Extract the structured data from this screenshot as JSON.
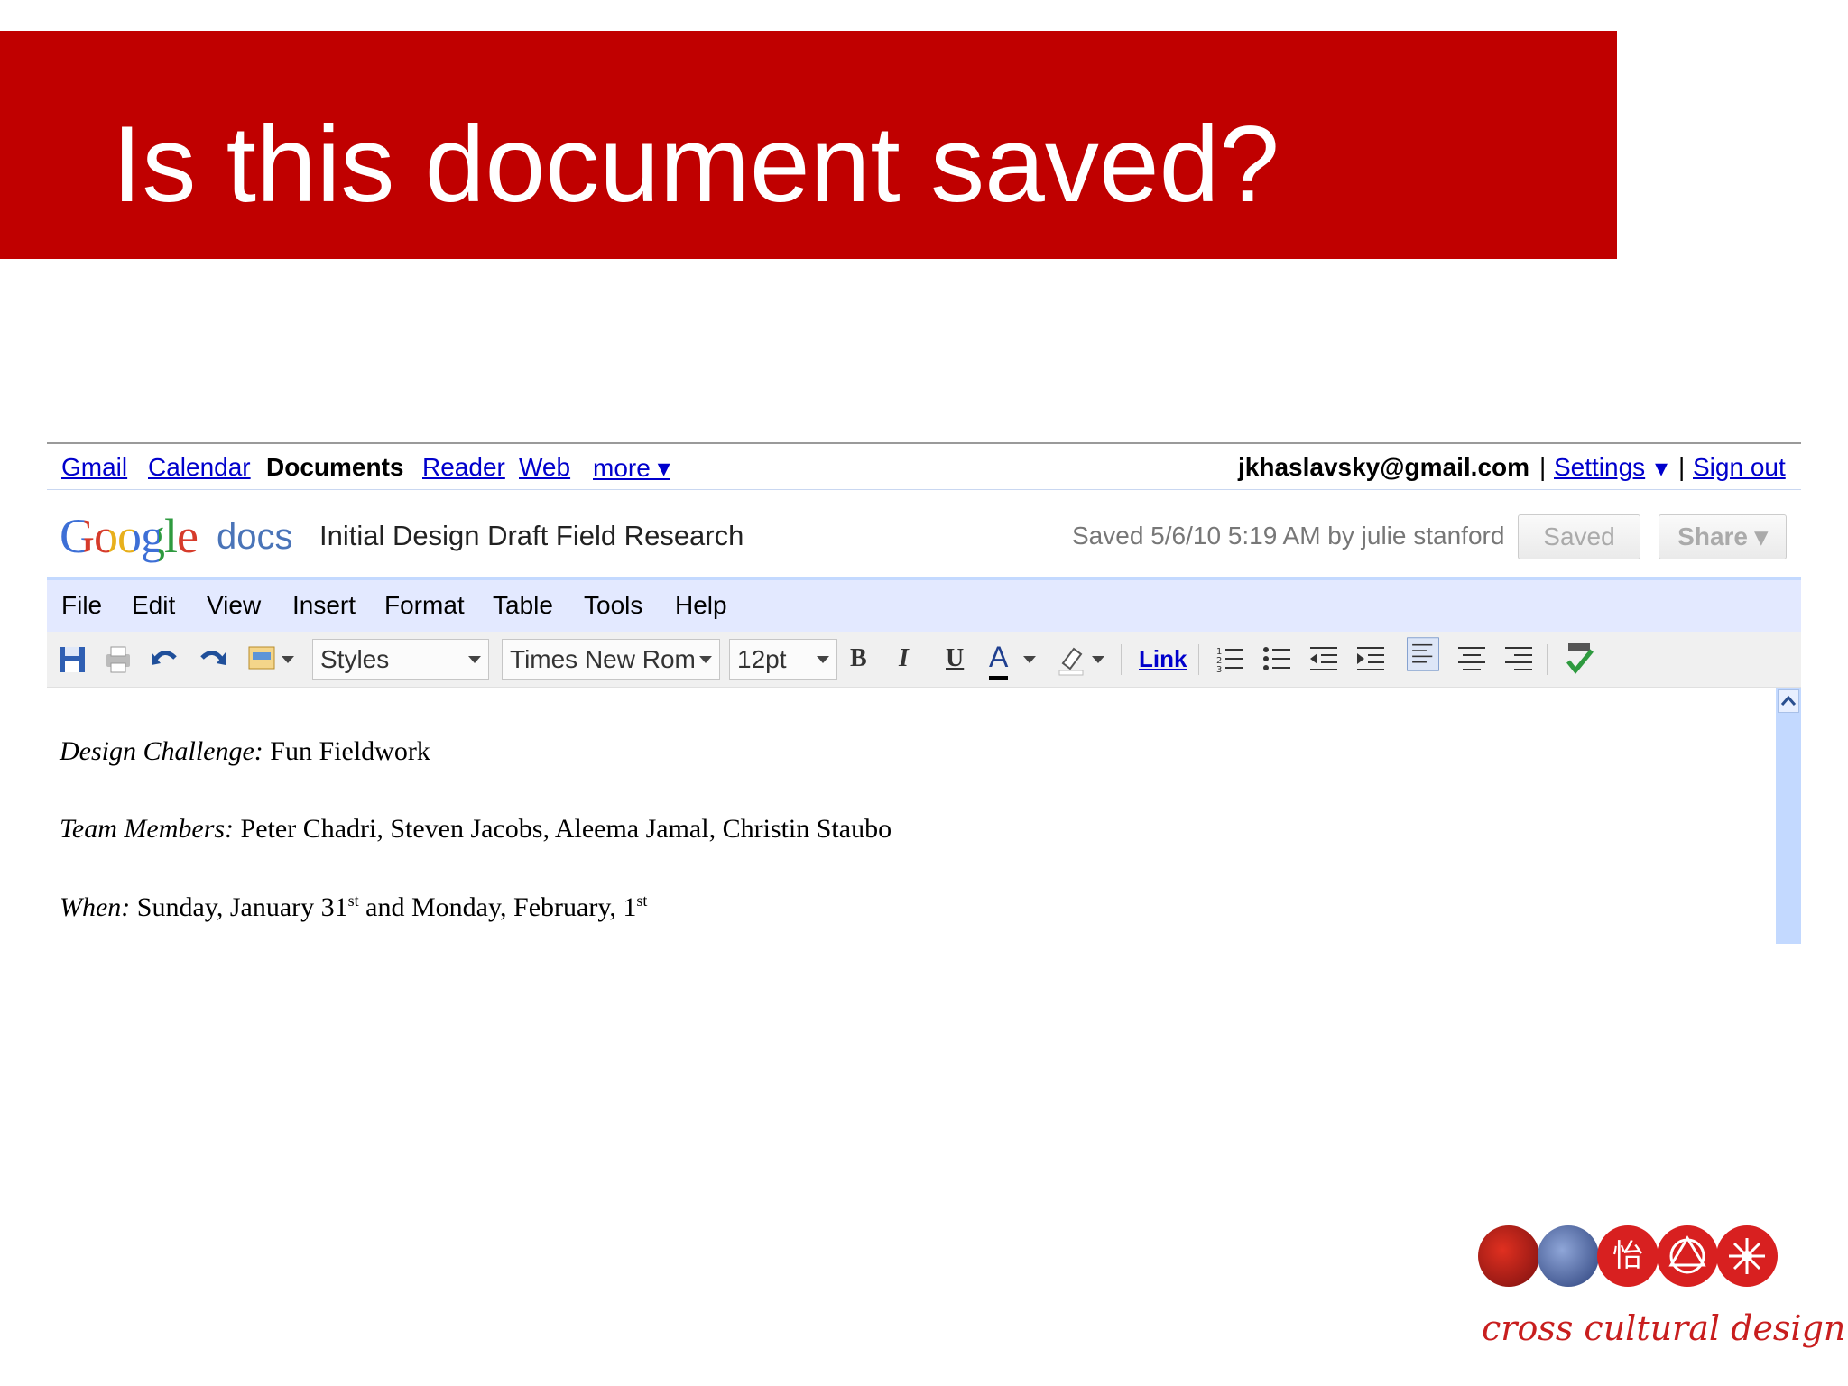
{
  "slide": {
    "title": "Is this document saved?"
  },
  "topnav": {
    "links": [
      "Gmail",
      "Calendar",
      "Documents",
      "Reader",
      "Web",
      "more ▾"
    ],
    "email": "jkhaslavsky@gmail.com",
    "settings": "Settings",
    "settings_arrow": "▾",
    "sep1": "|",
    "sep2": "|",
    "signout": "Sign out"
  },
  "header": {
    "logo_google": "Google",
    "logo_docs": "docs",
    "doc_title": "Initial Design Draft Field Research",
    "saved_status": "Saved 5/6/10 5:19 AM by julie stanford",
    "saved_button": "Saved",
    "share_button": "Share ▾"
  },
  "menu": [
    "File",
    "Edit",
    "View",
    "Insert",
    "Format",
    "Table",
    "Tools",
    "Help"
  ],
  "toolbar": {
    "styles": "Styles",
    "font": "Times New Rom",
    "size": "12pt",
    "bold": "B",
    "italic": "I",
    "underline": "U",
    "text_color": "A",
    "link": "Link"
  },
  "doc": {
    "line1": {
      "label": "Design Challenge:",
      "text": " Fun Fieldwork"
    },
    "line2": {
      "label": "Team Members:",
      "text": " Peter Chadri, Steven Jacobs, Aleema Jamal, Christin Staubo"
    },
    "line3": {
      "label": "When:",
      "text_a": " Sunday, January 31",
      "sup_a": "st",
      "text_b": " and Monday, February, 1",
      "sup_b": "st"
    }
  },
  "footer_logo": {
    "tagline": "cross cultural design",
    "glyph_chinese": "怡"
  },
  "colors": {
    "banner": "#c00000",
    "link": "#0000cc",
    "menubar": "#e3e9ff"
  }
}
